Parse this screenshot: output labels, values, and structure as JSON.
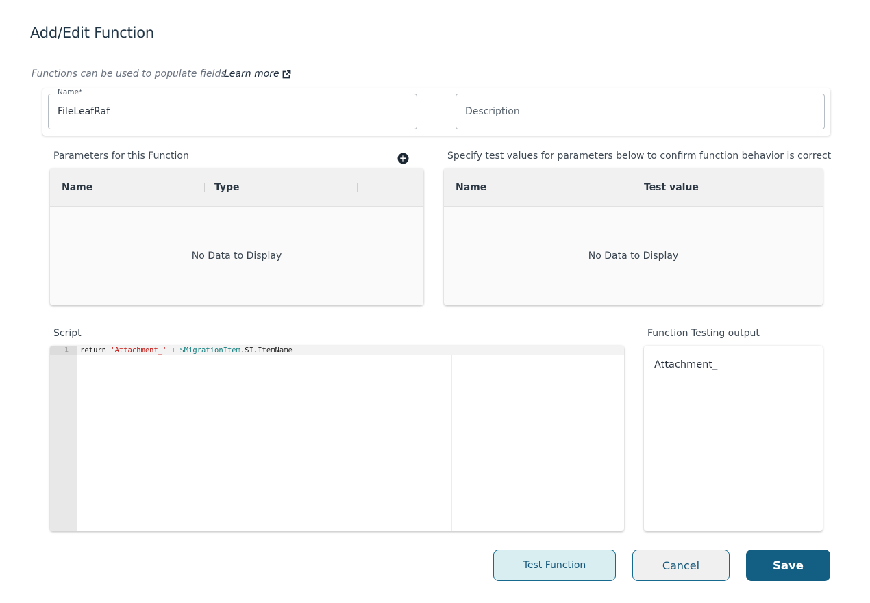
{
  "dialog": {
    "title": "Add/Edit Function",
    "intro_text": "Functions can be used to populate fields.",
    "learn_more_label": "Learn more",
    "icons": {
      "learn_more": "external-link-icon",
      "add_parameter": "plus-circle-icon"
    }
  },
  "name_field": {
    "label": "Name*",
    "value": "FileLeafRaf"
  },
  "description_field": {
    "placeholder": "Description",
    "value": ""
  },
  "parameters": {
    "label": "Parameters for this Function",
    "columns": [
      "Name",
      "Type"
    ],
    "rows": [],
    "empty_message": "No Data to Display"
  },
  "test_values": {
    "label": "Specify test values for parameters below to confirm function behavior is correct",
    "columns": [
      "Name",
      "Test value"
    ],
    "rows": [],
    "empty_message": "No Data to Display"
  },
  "script": {
    "label": "Script",
    "lines": [
      {
        "number": "1",
        "tokens": [
          {
            "text": "return ",
            "kind": "keyword"
          },
          {
            "text": "'Attachment_'",
            "kind": "string"
          },
          {
            "text": " + ",
            "kind": "operator"
          },
          {
            "text": "$MigrationItem",
            "kind": "variable"
          },
          {
            "text": ".SI.ItemName",
            "kind": "plain"
          }
        ]
      }
    ]
  },
  "output": {
    "label": "Function Testing output",
    "text": "Attachment_"
  },
  "buttons": {
    "test": "Test Function",
    "cancel": "Cancel",
    "save": "Save"
  },
  "colors": {
    "primary": "#135f83",
    "test_button_bg": "#d9eef0",
    "string_token": "#c41a16",
    "variable_token": "#0e7c7b"
  }
}
